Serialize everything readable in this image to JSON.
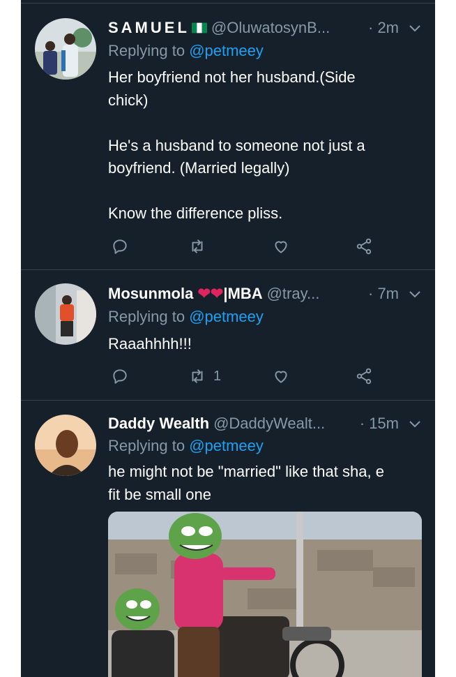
{
  "tweets": [
    {
      "name": "SAMUEL",
      "handle": "@OluwatosynB...",
      "time": "· 2m",
      "replying_prefix": "Replying to ",
      "replying_to": "@petmeey",
      "lines": [
        "Her boyfriend not her husband.(Side",
        "chick)",
        "",
        "He's a husband to someone not just a",
        "boyfriend. (Married legally)",
        "",
        "Know the difference pliss."
      ],
      "retweet_count": "",
      "flag_colors": [
        "#008751",
        "#ffffff",
        "#008751"
      ]
    },
    {
      "name": "Mosunmola ❤❤|MBA",
      "handle": "@tray...",
      "time": "· 7m",
      "replying_prefix": "Replying to ",
      "replying_to": "@petmeey",
      "lines": [
        "Raaahhhh!!!"
      ],
      "retweet_count": "1"
    },
    {
      "name": "Daddy Wealth",
      "handle": "@DaddyWealt...",
      "time": "· 15m",
      "replying_prefix": "Replying to ",
      "replying_to": "@petmeey",
      "lines": [
        "he might not be \"married\" like that  sha, e",
        "fit be small one"
      ]
    }
  ],
  "colors": {
    "background": "#15202b",
    "text": "#ffffff",
    "muted": "#8899a6",
    "link": "#1da1f2",
    "divider": "#38444d",
    "heart": "#e0245e"
  },
  "icons": [
    "reply-icon",
    "retweet-icon",
    "like-icon",
    "share-icon",
    "chevron-down-icon"
  ]
}
